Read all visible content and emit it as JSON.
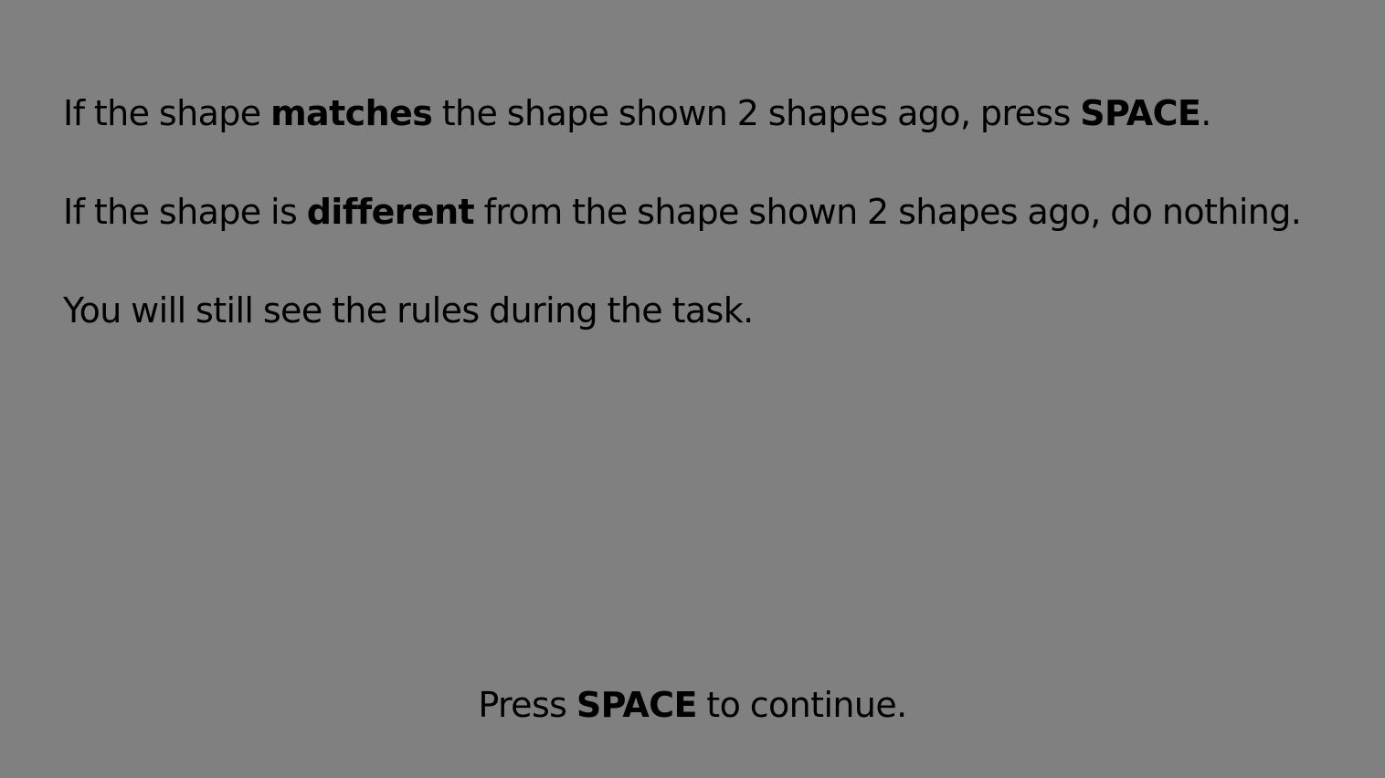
{
  "instructions": {
    "rule1": {
      "before": "If the shape ",
      "bold1": "matches",
      "middle": " the shape shown 2 shapes ago, press ",
      "bold2": "SPACE",
      "after": "."
    },
    "rule2": {
      "before": "If the shape is ",
      "bold": "different",
      "after": " from the shape shown 2 shapes ago, do nothing."
    },
    "note": "You will still see the rules during the task."
  },
  "footer": {
    "before": "Press ",
    "key": "SPACE",
    "after": " to continue."
  },
  "colors": {
    "background": "#808080",
    "text": "#000000"
  }
}
